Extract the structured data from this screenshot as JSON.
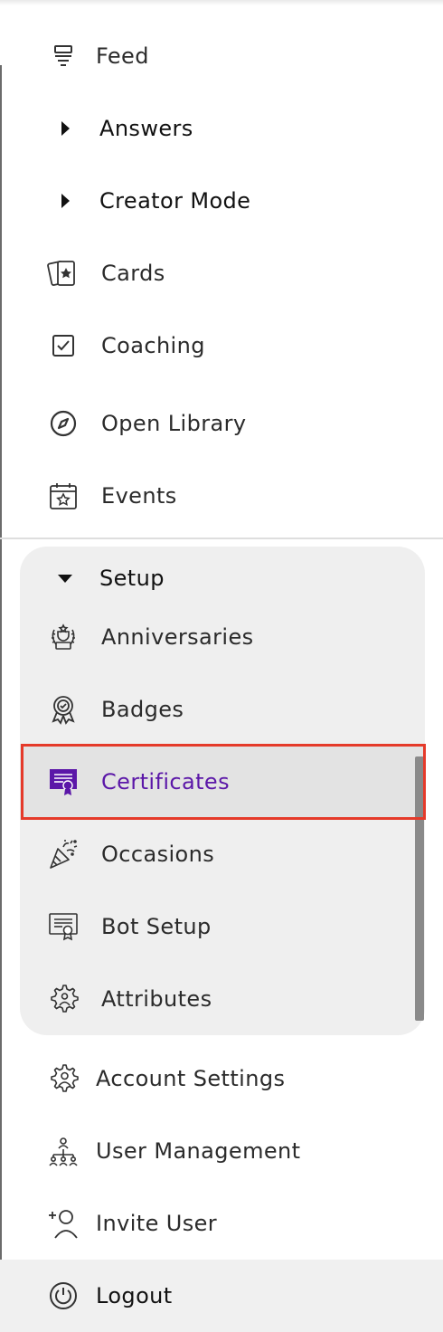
{
  "nav": {
    "feed": {
      "label": "Feed",
      "icon": "feed-icon"
    },
    "answers": {
      "label": "Answers",
      "icon": "caret-right-icon"
    },
    "creator_mode": {
      "label": "Creator Mode",
      "icon": "caret-right-icon"
    },
    "cards": {
      "label": "Cards",
      "icon": "cards-icon"
    },
    "coaching": {
      "label": "Coaching",
      "icon": "checkbox-icon"
    },
    "open_library": {
      "label": "Open Library",
      "icon": "compass-icon"
    },
    "events": {
      "label": "Events",
      "icon": "calendar-star-icon"
    }
  },
  "setup": {
    "label": "Setup",
    "expanded": true,
    "items": [
      {
        "label": "Anniversaries",
        "icon": "laurel-trophy-icon"
      },
      {
        "label": "Badges",
        "icon": "badge-icon"
      },
      {
        "label": "Certificates",
        "icon": "certificate-icon",
        "selected": true
      },
      {
        "label": "Occasions",
        "icon": "party-popper-icon"
      },
      {
        "label": "Bot Setup",
        "icon": "bot-setup-icon"
      },
      {
        "label": "Attributes",
        "icon": "gear-user-icon"
      }
    ]
  },
  "bottom": {
    "account_settings": {
      "label": "Account Settings",
      "icon": "user-gear-icon"
    },
    "user_management": {
      "label": "User Management",
      "icon": "org-chart-icon"
    },
    "invite_user": {
      "label": "Invite User",
      "icon": "add-user-icon"
    },
    "logout": {
      "label": "Logout",
      "icon": "power-icon"
    }
  },
  "colors": {
    "selected_text": "#5b17a8",
    "highlight_border": "#e53a2a",
    "text": "#2b2b2b",
    "setup_panel_bg": "#efefef"
  }
}
